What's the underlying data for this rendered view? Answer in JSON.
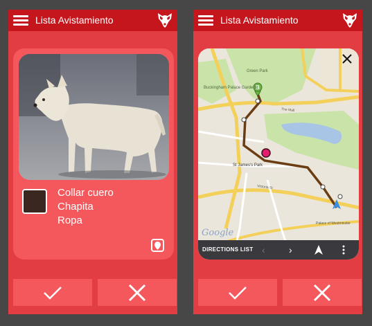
{
  "screens": [
    {
      "app_bar": {
        "title": "Lista Avistamiento"
      },
      "card": {
        "color_swatch": "#3a2820",
        "items": [
          "Collar cuero",
          "Chapita",
          "Ropa"
        ]
      }
    },
    {
      "app_bar": {
        "title": "Lista Avistamiento"
      },
      "map": {
        "labels": {
          "buckingham": "Buckingham Palace Gardens",
          "green_park": "Green Park",
          "the_mall": "The Mall",
          "st_james": "St James's Park",
          "victoria_st": "Victoria St",
          "palace_westminster": "Palace of Westminster"
        },
        "marker_label": "B",
        "directions_label": "DIRECTIONS LIST",
        "google_label": "Google"
      }
    }
  ],
  "colors": {
    "background": "#474747",
    "app_bar": "#c6161d",
    "screen": "#e23d43",
    "card": "#f5585c"
  }
}
